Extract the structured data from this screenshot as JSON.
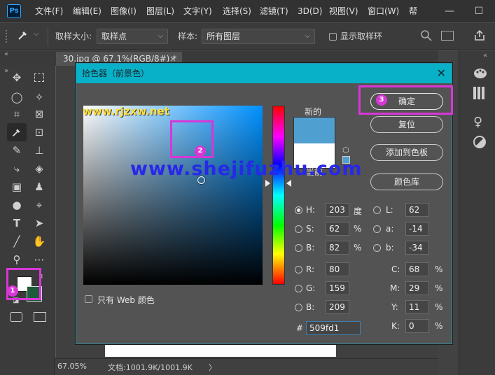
{
  "app": {
    "logo": "Ps"
  },
  "menu": [
    {
      "label": "文件(F)"
    },
    {
      "label": "编辑(E)"
    },
    {
      "label": "图像(I)"
    },
    {
      "label": "图层(L)"
    },
    {
      "label": "文字(Y)"
    },
    {
      "label": "选择(S)"
    },
    {
      "label": "滤镜(T)"
    },
    {
      "label": "3D(D)"
    },
    {
      "label": "视图(V)"
    },
    {
      "label": "窗口(W)"
    },
    {
      "label": "帮"
    }
  ],
  "window_controls": {
    "minimize": "—",
    "maximize": "☐"
  },
  "options_bar": {
    "sample_size_label": "取样大小:",
    "sample_size_value": "取样点",
    "sample_label": "样本:",
    "sample_value": "所有图层",
    "show_ring_label": "显示取样环"
  },
  "document_tab": {
    "title": "30.jpg @ 67.1%(RGB/8#) *",
    "close": "×"
  },
  "status_bar": {
    "zoom": "67.05%",
    "doc": "文档:1001.9K/1001.9K",
    "arrow": "〉"
  },
  "dialog": {
    "title": "拾色器（前景色）",
    "close": "✕",
    "new_label": "新的",
    "current_label": "当前",
    "web_only_label": "只有 Web 颜色",
    "buttons": {
      "ok": "确定",
      "reset": "复位",
      "add_swatch": "添加到色板",
      "libraries": "颜色库"
    },
    "fields": {
      "H": {
        "label": "H:",
        "value": "203",
        "unit": "度"
      },
      "S": {
        "label": "S:",
        "value": "62",
        "unit": "%"
      },
      "Bv": {
        "label": "B:",
        "value": "82",
        "unit": "%"
      },
      "R": {
        "label": "R:",
        "value": "80"
      },
      "G": {
        "label": "G:",
        "value": "159"
      },
      "Bl": {
        "label": "B:",
        "value": "209"
      },
      "L": {
        "label": "L:",
        "value": "62"
      },
      "a": {
        "label": "a:",
        "value": "-14"
      },
      "b": {
        "label": "b:",
        "value": "-34"
      },
      "C": {
        "label": "C:",
        "value": "68",
        "unit": "%"
      },
      "M": {
        "label": "M:",
        "value": "29",
        "unit": "%"
      },
      "Y": {
        "label": "Y:",
        "value": "11",
        "unit": "%"
      },
      "K": {
        "label": "K:",
        "value": "0",
        "unit": "%"
      },
      "hex": {
        "label": "#",
        "value": "509fd1"
      }
    },
    "colors": {
      "new": "#509fd1",
      "current": "#ffffff"
    }
  },
  "annotations": {
    "n1": "1",
    "n2": "2",
    "n3": "3"
  },
  "watermarks": {
    "rjzxw": "www.rjzxw.net",
    "shejifuzhu": "www.shejifuzhu.com"
  },
  "colors": {
    "accent_title": "#08b0c8",
    "annotation": "#d936d8"
  }
}
